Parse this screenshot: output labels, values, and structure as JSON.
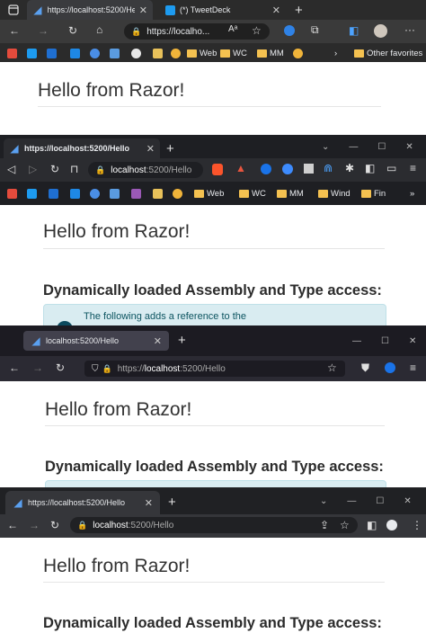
{
  "frame1": {
    "tabs": [
      {
        "title": "https://localhost:5200/He",
        "active": true
      },
      {
        "title": "(*) TweetDeck",
        "active": false
      }
    ],
    "url": "https://localho...",
    "bookmarks": [
      "Web",
      "WC",
      "MM"
    ],
    "other_favorites": "Other favorites",
    "page_title": "Hello from Razor!"
  },
  "frame2": {
    "tab_title": "https://localhost:5200/Hello",
    "url_host": "localhost",
    "url_rest": ":5200/Hello",
    "bookmarks": [
      "Web",
      "WC",
      "MM",
      "Wind",
      "Fin"
    ],
    "page_title": "Hello from Razor!",
    "section_title": "Dynamically loaded Assembly and Type access:",
    "alert_text": "The following adds a reference to the"
  },
  "frame3": {
    "tab_title": "localhost:5200/Hello",
    "url_prefix": "https://",
    "url_host": "localhost",
    "url_rest": ":5200/Hello",
    "page_title": "Hello from Razor!",
    "section_title": "Dynamically loaded Assembly and Type access:"
  },
  "frame4": {
    "tab_title": "https://localhost:5200/Hello",
    "url_host": "localhost",
    "url_rest": ":5200/Hello",
    "page_title": "Hello from Razor!",
    "section_title": "Dynamically loaded Assembly and Type access:"
  },
  "colors": {
    "chrome_dark": "#202124",
    "alert_bg": "#d9ecf1",
    "heading_text": "#333333"
  }
}
